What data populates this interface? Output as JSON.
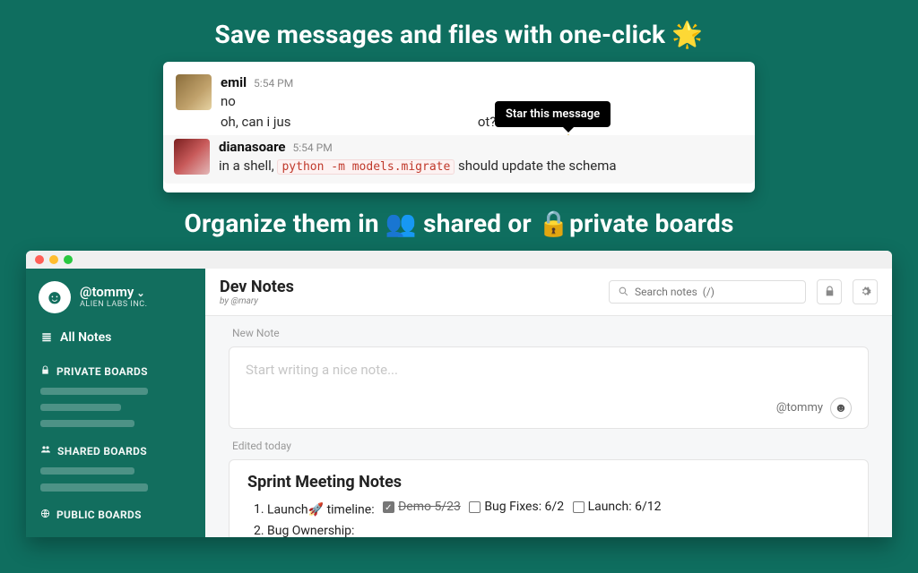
{
  "hero": {
    "line1_pre": "Save messages and files with one-click ",
    "line2_pre": "Organize them in ",
    "line2_mid1": " shared or ",
    "line2_mid2": "private boards"
  },
  "chat": {
    "tooltip": "Star this message",
    "msg1": {
      "user": "emil",
      "time": "5:54 PM",
      "line1": "no",
      "line2a": "oh, can i jus",
      "line2b": "ot?"
    },
    "msg2": {
      "user": "dianasoare",
      "time": "5:54 PM",
      "pre": "in a shell, ",
      "code": "python -m models.migrate",
      "post": " should update the schema"
    }
  },
  "app": {
    "sidebar": {
      "handle": "@tommy",
      "org": "ALIEN LABS INC.",
      "all_notes": "All Notes",
      "private": "PRIVATE BOARDS",
      "shared": "SHARED BOARDS",
      "public": "PUBLIC BOARDS"
    },
    "main": {
      "title": "Dev Notes",
      "by": "by @mary",
      "search_ph": "Search notes  (/)",
      "new_note_label": "New Note",
      "compose_ph": "Start writing a nice note...",
      "compose_author": "@tommy",
      "edited_label": "Edited today",
      "note": {
        "title": "Sprint Meeting Notes",
        "li1_pre": "Launch",
        "li1_mid": "  timeline:",
        "chip1": "Demo 5/23",
        "chip2": "Bug Fixes: 6/2",
        "chip3": "Launch: 6/12",
        "li2": "Bug Ownership:"
      }
    }
  }
}
